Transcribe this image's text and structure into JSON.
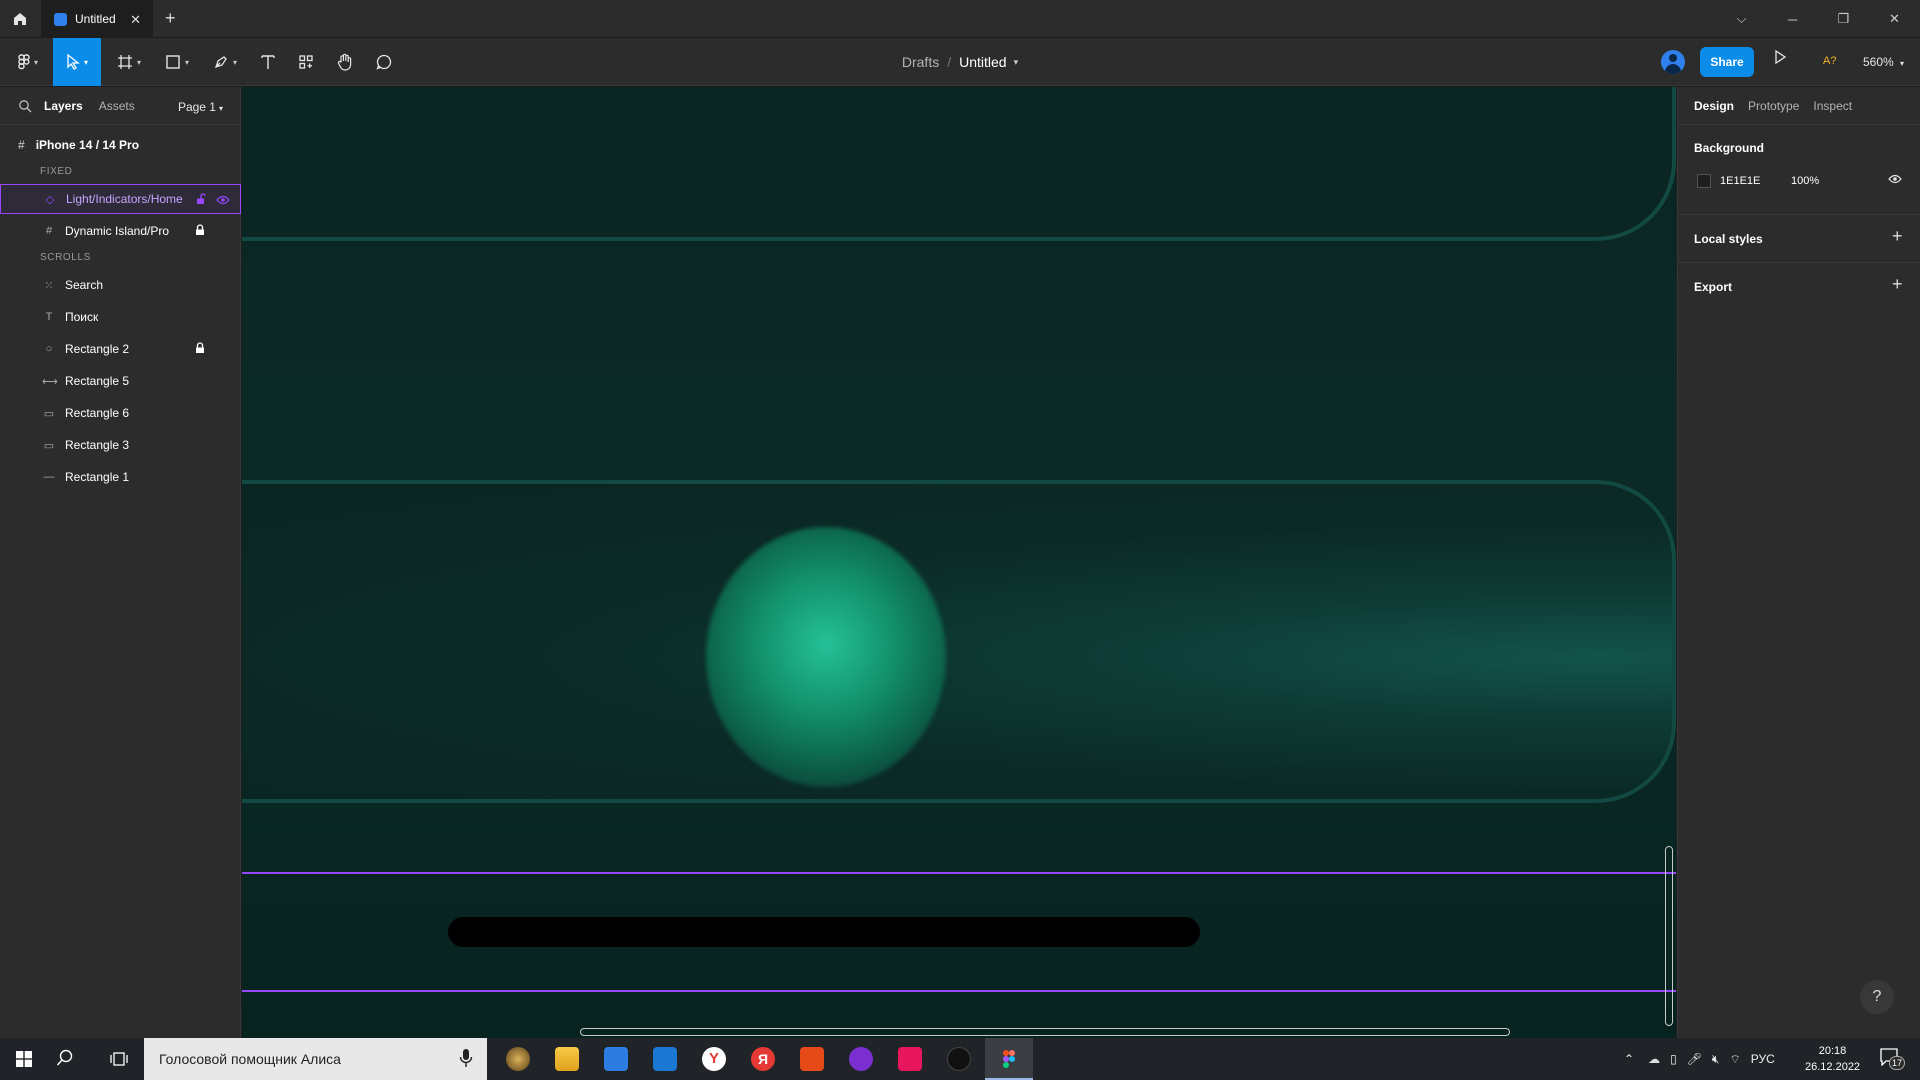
{
  "browser": {
    "tab_title": "Untitled",
    "new_tab": "+"
  },
  "toolbar": {
    "breadcrumb_root": "Drafts",
    "breadcrumb_separator": "/",
    "file_title": "Untitled",
    "share_label": "Share",
    "accessibility_label": "A?",
    "zoom_level": "560%"
  },
  "layers_panel": {
    "tabs": [
      "Layers",
      "Assets"
    ],
    "page": "Page 1",
    "frame_name": "iPhone 14 / 14 Pro",
    "section_fixed": "FIXED",
    "section_scrolls": "SCROLLS",
    "fixed_layers": [
      {
        "name": "Light/Indicators/Home",
        "icon": "component-instance-icon",
        "selected": true,
        "locked": false
      },
      {
        "name": "Dynamic Island/Pro",
        "icon": "frame-icon",
        "selected": false,
        "locked": true
      }
    ],
    "scroll_layers": [
      {
        "name": "Search",
        "icon": "dotted-frame-icon",
        "locked": false
      },
      {
        "name": "Поиск",
        "icon": "text-icon",
        "locked": false
      },
      {
        "name": "Rectangle 2",
        "icon": "ellipse-icon",
        "locked": true
      },
      {
        "name": "Rectangle 5",
        "icon": "line-icon",
        "locked": false
      },
      {
        "name": "Rectangle 6",
        "icon": "rectangle-icon",
        "locked": false
      },
      {
        "name": "Rectangle 3",
        "icon": "rectangle-icon",
        "locked": false
      },
      {
        "name": "Rectangle 1",
        "icon": "line-icon",
        "locked": false
      }
    ]
  },
  "design_panel": {
    "tabs": [
      "Design",
      "Prototype",
      "Inspect"
    ],
    "background_heading": "Background",
    "background_hex": "1E1E1E",
    "background_opacity": "100%",
    "local_styles_heading": "Local styles",
    "export_heading": "Export",
    "help_label": "?"
  },
  "taskbar": {
    "search_placeholder": "Голосовой помощник Алиса",
    "language": "РУС",
    "time": "20:18",
    "date": "26.12.2022",
    "notifications": "17"
  },
  "colors": {
    "accent": "#0c8ce9",
    "selection": "#9747ff",
    "canvas_bg": "#0a2521",
    "orb": "#25c197"
  }
}
